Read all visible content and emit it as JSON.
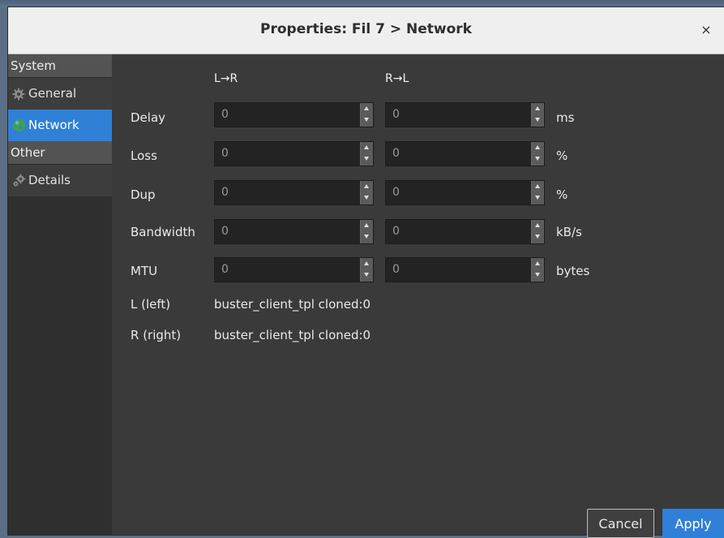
{
  "window": {
    "title": "Properties: Fil 7 > Network",
    "close_glyph": "×"
  },
  "sidebar": {
    "sections": [
      {
        "heading": "System",
        "items": [
          {
            "label": "General",
            "icon": "gear-icon",
            "active": false
          },
          {
            "label": "Network",
            "icon": "globe-icon",
            "active": true
          }
        ]
      },
      {
        "heading": "Other",
        "items": [
          {
            "label": "Details",
            "icon": "gears-icon",
            "active": false
          }
        ]
      }
    ]
  },
  "network": {
    "columns": {
      "lr": "L→R",
      "rl": "R→L"
    },
    "rows": [
      {
        "label": "Delay",
        "lr": "0",
        "rl": "0",
        "unit": "ms"
      },
      {
        "label": "Loss",
        "lr": "0",
        "rl": "0",
        "unit": "%"
      },
      {
        "label": "Dup",
        "lr": "0",
        "rl": "0",
        "unit": "%"
      },
      {
        "label": "Bandwidth",
        "lr": "0",
        "rl": "0",
        "unit": "kB/s"
      },
      {
        "label": "MTU",
        "lr": "0",
        "rl": "0",
        "unit": "bytes"
      }
    ],
    "left": {
      "label": "L (left)",
      "value": "buster_client_tpl cloned:0"
    },
    "right": {
      "label": "R (right)",
      "value": "buster_client_tpl cloned:0"
    }
  },
  "buttons": {
    "cancel": "Cancel",
    "apply": "Apply"
  },
  "colors": {
    "accent": "#2f80d6",
    "panel": "#3a3a3a",
    "sidebar": "#2f2f2f",
    "field": "#232323"
  }
}
